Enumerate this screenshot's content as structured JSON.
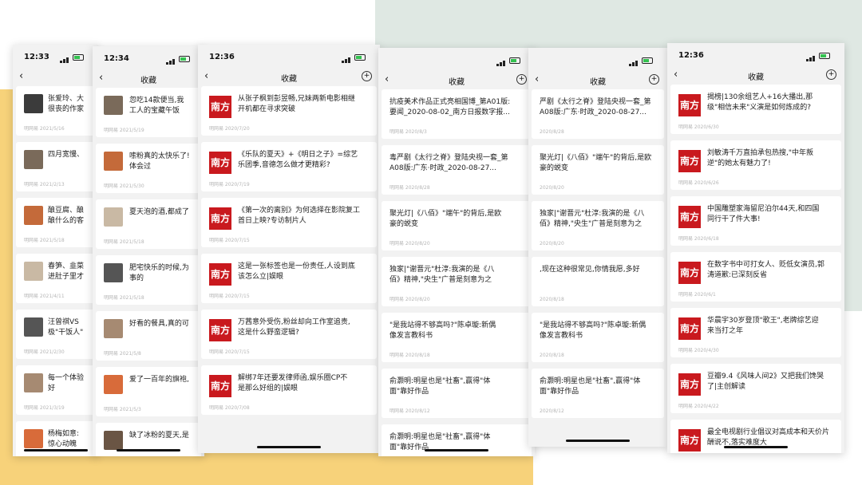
{
  "colors": {
    "brand": "#c9191e",
    "mint": "#dfe8e3",
    "yellow": "#f7d27a"
  },
  "icons": {
    "back": "‹",
    "add": "+",
    "logo": "南方+"
  },
  "phones": [
    {
      "time": "12:33",
      "title": "",
      "items": [
        {
          "text": "张爱玲、大",
          "text2": "很丧的作家",
          "meta": "明网易 2021/5/16"
        },
        {
          "text": "四月宽慢、",
          "text2": "",
          "meta": "明网易 2021/2/13"
        },
        {
          "text": "酿豆腐、酿",
          "text2": "酿什么的客",
          "meta": "明网易 2021/5/18"
        },
        {
          "text": "春笋、韭菜",
          "text2": "进肚子里才",
          "meta": "明网易 2021/4/11"
        },
        {
          "text": "汪曾祺VS",
          "text2": "极\"干饭人\"",
          "meta": "明网易 2021/2/30"
        },
        {
          "text": "每一个体验",
          "text2": "好",
          "meta": "明网易 2021/3/19"
        },
        {
          "text": "杨梅如意:",
          "text2": "惊心动魄",
          "meta": ""
        }
      ]
    },
    {
      "time": "12:34",
      "title": "收藏",
      "items": [
        {
          "text": "忽吃14款便当,我",
          "text2": "工人的宝藏午饭",
          "meta": "明网易 2021/5/19"
        },
        {
          "text": "嗦粉真的太快乐了!",
          "text2": "体会过",
          "meta": "明网易 2021/5/30"
        },
        {
          "text": "夏天泡的酒,都成了",
          "text2": "",
          "meta": "明网易 2021/5/18"
        },
        {
          "text": "肥宅快乐的时候,为",
          "text2": "事的",
          "meta": "明网易 2021/5/18"
        },
        {
          "text": "好看的餐具,真的可",
          "text2": "",
          "meta": "明网易 2021/5/8"
        },
        {
          "text": "爱了一百年的旗袍,",
          "text2": "",
          "meta": "明网易 2021/5/3"
        },
        {
          "text": "缺了冰粉的夏天,是",
          "text2": "",
          "meta": ""
        }
      ]
    },
    {
      "time": "12:36",
      "title": "收藏",
      "items": [
        {
          "text": "从张子枫到彭昱畅,兄妹两新电影相继",
          "text2": "开机都在寻求突破",
          "meta": "明网易 2020/7/20"
        },
        {
          "text": "《乐队的夏天》+《明日之子》=综艺",
          "text2": "乐团季,音德怎么做才更精彩?",
          "meta": "明网易 2020/7/19"
        },
        {
          "text": "《第一次的离别》为何选择在影院复工",
          "text2": "首日上映?专访制片人",
          "meta": "明网易 2020/7/15"
        },
        {
          "text": "这是一张标签也是一份责任,人设到底",
          "text2": "该怎么立|娱眼",
          "meta": "明网易 2020/7/15"
        },
        {
          "text": "万茜意外受伤,粉丝却向工作室追责,",
          "text2": "这是什么野蛮逻辑?",
          "meta": "明网易 2020/7/15"
        },
        {
          "text": "解绑7年还要发律师函,娱乐圈CP不",
          "text2": "是那么好组的|娱眼",
          "meta": "明网易 2020/7/08"
        }
      ]
    },
    {
      "time": "",
      "title": "收藏",
      "items": [
        {
          "text": "抗疫美术作品正式亮相国博_第A01版:",
          "text2": "要闻_2020-08-02_南方日报数字报...",
          "meta": "明网易 2020/8/3"
        },
        {
          "text": "毒严剧《太行之脊》登陆央视一套_第",
          "text2": "A08版:广东·时政_2020-08-27...",
          "meta": "明网易 2020/8/28"
        },
        {
          "text": "聚光灯|《八佰》\"端午\"的背后,是欧",
          "text2": "豪的蜕变",
          "meta": "明网易 2020/8/20"
        },
        {
          "text": "独家|\"谢晋元\"杜淳:我演的是《八",
          "text2": "佰》精神,\"央生\"广普是刻意为之",
          "meta": "明网易 2020/8/20"
        },
        {
          "text": "\"是我站得不够高吗?\"陈卓璇:新偶",
          "text2": "像发言教科书",
          "meta": "明网易 2020/8/18"
        },
        {
          "text": "俞灏明:明星也是\"社畜\",赢得\"体",
          "text2": "面\"靠好作品",
          "meta": "明网易 2020/8/12"
        },
        {
          "text": "俞灏明:明星也是\"社畜\",赢得\"体",
          "text2": "面\"靠好作品",
          "meta": ""
        }
      ]
    },
    {
      "time": "",
      "title": "收藏",
      "items": [
        {
          "text": "严剧《太行之脊》登陆央视一套_第",
          "text2": "A08版:广东·时政_2020-08-27...",
          "meta": "2020/8/28"
        },
        {
          "text": "聚光灯|《八佰》\"端午\"的背后,是欧",
          "text2": "豪的蜕变",
          "meta": "2020/8/20"
        },
        {
          "text": "独家|\"谢晋元\"杜淳:我演的是《八",
          "text2": "佰》精神,\"央生\"广普是刻意为之",
          "meta": "2020/8/20"
        },
        {
          "text": ",现在这种很常见,你情我愿,多好",
          "text2": "",
          "meta": "2020/8/18"
        },
        {
          "text": "\"是我站得不够高吗?\"陈卓璇:新偶",
          "text2": "像发言教科书",
          "meta": "2020/8/18"
        },
        {
          "text": "俞灏明:明星也是\"社畜\",赢得\"体",
          "text2": "面\"靠好作品",
          "meta": "2020/8/12"
        }
      ]
    },
    {
      "time": "12:36",
      "title": "收藏",
      "items": [
        {
          "text": "揭榜|130余组艺人+16大播出,那",
          "text2": "级\"相信未来\"义演是如何炼成的?",
          "meta": "明网易 2020/6/30"
        },
        {
          "text": "刘敏涛千万直拍承包热搜,\"中年叛",
          "text2": "逆\"的她太有魅力了!",
          "meta": "明网易 2020/6/26"
        },
        {
          "text": "中国雕塑家海留尼泊尔44天,和四国",
          "text2": "同行干了件大事!",
          "meta": "明网易 2020/6/18"
        },
        {
          "text": "在数字书中可打女人、贬低女演员,郭",
          "text2": "涛道歉:已深刻反省",
          "meta": "明网易 2020/6/1"
        },
        {
          "text": "华晨宇30岁登顶\"歌王\",老牌综艺迎",
          "text2": "来当打之年",
          "meta": "明网易 2020/4/30"
        },
        {
          "text": "豆瓣9.4《风味人间2》又把我们馋哭",
          "text2": "了|主创解读",
          "meta": "明网易 2020/4/22"
        },
        {
          "text": "最全电视剧行业倡议对高成本和天价片",
          "text2": "酬说不,落实难度大",
          "meta": ""
        }
      ]
    }
  ]
}
